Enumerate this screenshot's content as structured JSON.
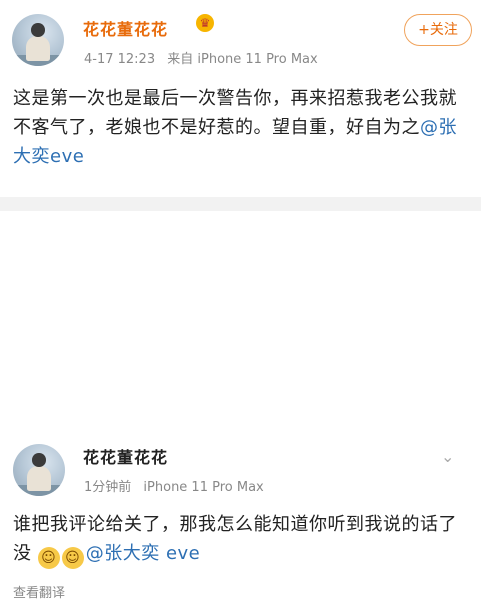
{
  "post1": {
    "username": "花花董花花",
    "badge": "♛",
    "date": "4-17 12:23",
    "source": "来自 iPhone 11 Pro Max",
    "follow_label": "+关注",
    "content_text": "这是第一次也是最后一次警告你，再来招惹我老公我就不客气了，老娘也不是好惹的。望自重，好自为之",
    "mention": "@张大奕eve"
  },
  "post2": {
    "username": "花花董花花",
    "time": "1分钟前",
    "source": "iPhone 11 Pro Max",
    "content_text": "谁把我评论给关了，那我怎么能知道你听到我说的话了没",
    "emoji1": "☺",
    "emoji2": "☺",
    "mention": "@张大奕 eve",
    "chevron": "⌄",
    "translate_label": "查看翻译"
  },
  "colors": {
    "brand_orange": "#e86b0b",
    "mention_blue": "#2d6fb3",
    "divider_gray": "#f2f2f2"
  },
  "icons": [
    "avatar-image",
    "vip-badge-icon",
    "chevron-down-icon",
    "smile-emoji-icon"
  ]
}
